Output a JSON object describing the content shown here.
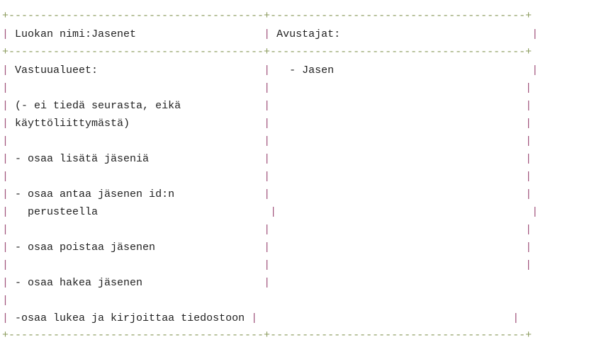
{
  "card": {
    "class_name": "Luokan nimi:Jasenet",
    "collaborators_label": "Avustajat:",
    "responsibilities_label": "Vastuualueet:",
    "responsibilities": [
      "(- ei tiedä seurasta, eikä",
      "käyttöliittymästä)",
      "- osaa lisätä jäseniä",
      "- osaa antaa jäsenen id:n",
      "  perusteella",
      "- osaa poistaa jäsenen",
      "- osaa hakea jäsenen",
      "-osaa lukea ja kirjoittaa tiedostoon"
    ],
    "collaborators": [
      "  - Jasen"
    ]
  }
}
